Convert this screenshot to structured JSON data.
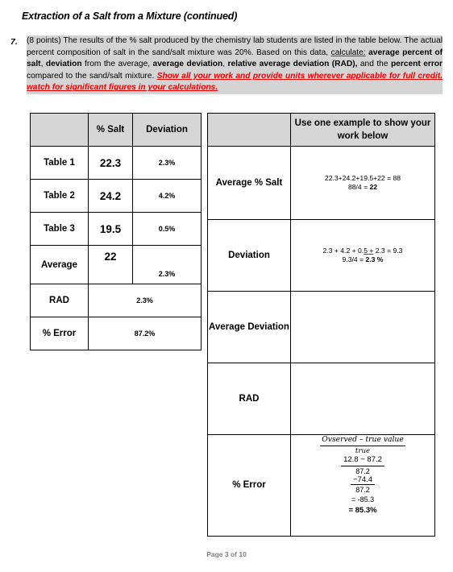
{
  "document": {
    "title": "Extraction of a Salt from a Mixture (continued)",
    "footer": "Page 3 of 10"
  },
  "question": {
    "number": "7.",
    "points": "(8 points)",
    "text_part1": "(8 points) The results of the % salt produced by the chemistry lab students are listed in the table below. The actual percent composition of salt in the sand/salt mixture was 20%. Based on this data, ",
    "underlined_word": "calculate:",
    "text_part2": " ",
    "bold1": "average percent of salt",
    "text_part3": ", ",
    "bold2": "deviation",
    "text_part4": " from the average, ",
    "bold3": "average deviation",
    "text_part5": ", ",
    "bold4": "relative average deviation (RAD),",
    "text_part6": " and the ",
    "bold5": "percent error",
    "text_part7": " compared to the sand/salt mixture. ",
    "red_note": "Show all your work and provide units wherever applicable for full credit. watch for significant figures in your calculations."
  },
  "left_table": {
    "headers": [
      "",
      "% Salt",
      "Deviation"
    ],
    "rows": [
      {
        "label": "Table 1",
        "salt": "22.3",
        "deviation": "2.3%",
        "merged": false
      },
      {
        "label": "Table 2",
        "salt": "24.2",
        "deviation": "4.2%",
        "merged": false
      },
      {
        "label": "Table 3",
        "salt": "19.5",
        "deviation": "0.5%",
        "merged": false
      },
      {
        "label": "Average",
        "salt": "22",
        "deviation": "2.3%",
        "merged": false
      },
      {
        "label": "RAD",
        "value": "2.3%",
        "merged": true
      },
      {
        "label": "% Error",
        "value": "87.2%",
        "merged": true
      }
    ]
  },
  "right_table": {
    "header_blank": "",
    "header_text": "Use one example to show your work below",
    "rows": [
      {
        "label": "Average % Salt",
        "work_line1": "22.3+24.2+19.5+22 = 88",
        "work_line2_pre": "88/4 = ",
        "work_line2_bold": "22"
      },
      {
        "label": "Deviation",
        "work_line1_a": "2.3 + 4.2 + 0.",
        "work_line1_underline": "5 +",
        "work_line1_b": " 2.3 = 9.3",
        "work_line2_pre": "9.3/4 = ",
        "work_line2_bold": "2.3 %"
      },
      {
        "label": "Average Deviation",
        "work": ""
      },
      {
        "label": "RAD",
        "work": ""
      },
      {
        "label": "% Error",
        "math_numerator": "Ovserved – true value",
        "math_denominator_label": "true",
        "math_line1": "12.8 − 87.2",
        "math_line2": "87.2",
        "math_line3": "−74.4",
        "math_line4": "87.2",
        "math_line5": "= -85.3",
        "math_result": "= 85.3%"
      }
    ]
  },
  "colors": {
    "header_gray": "#d6d6d6",
    "highlight_gray": "#d4d4d4",
    "red_note": "#ee0000",
    "underline_blue": "#2a4b8d",
    "footer_gray": "#7f7f7f"
  }
}
